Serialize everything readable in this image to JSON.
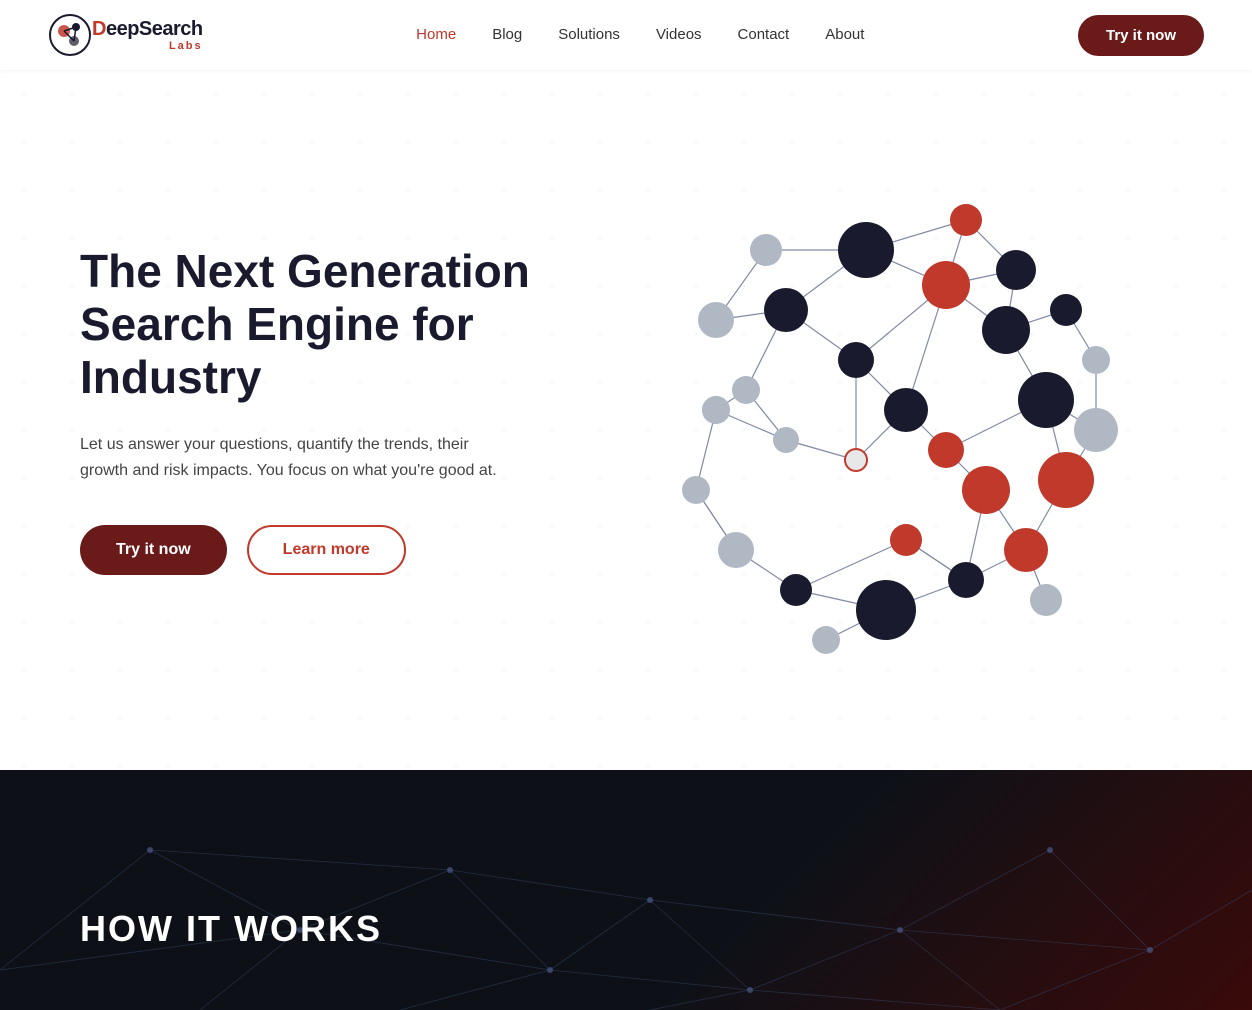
{
  "logo": {
    "main_text": "DeepSearch",
    "highlight": "Deep",
    "sub_text": "Labs"
  },
  "nav": {
    "links": [
      {
        "label": "Home",
        "active": true
      },
      {
        "label": "Blog",
        "active": false
      },
      {
        "label": "Solutions",
        "active": false
      },
      {
        "label": "Videos",
        "active": false
      },
      {
        "label": "Contact",
        "active": false
      },
      {
        "label": "About",
        "active": false
      }
    ],
    "cta_label": "Try it now"
  },
  "hero": {
    "title": "The Next Generation Search Engine for Industry",
    "description": "Let us answer your questions, quantify the trends, their growth and risk impacts. You focus on what you're good at.",
    "try_label": "Try it now",
    "learn_label": "Learn more"
  },
  "dark_section": {
    "heading": "HOW IT WORKS"
  },
  "colors": {
    "dark_navy": "#1a1a2e",
    "red": "#c0392b",
    "dark_red": "#6b1a1a",
    "gray_node": "#b0b8c4",
    "bg_dark": "#0d1117"
  }
}
